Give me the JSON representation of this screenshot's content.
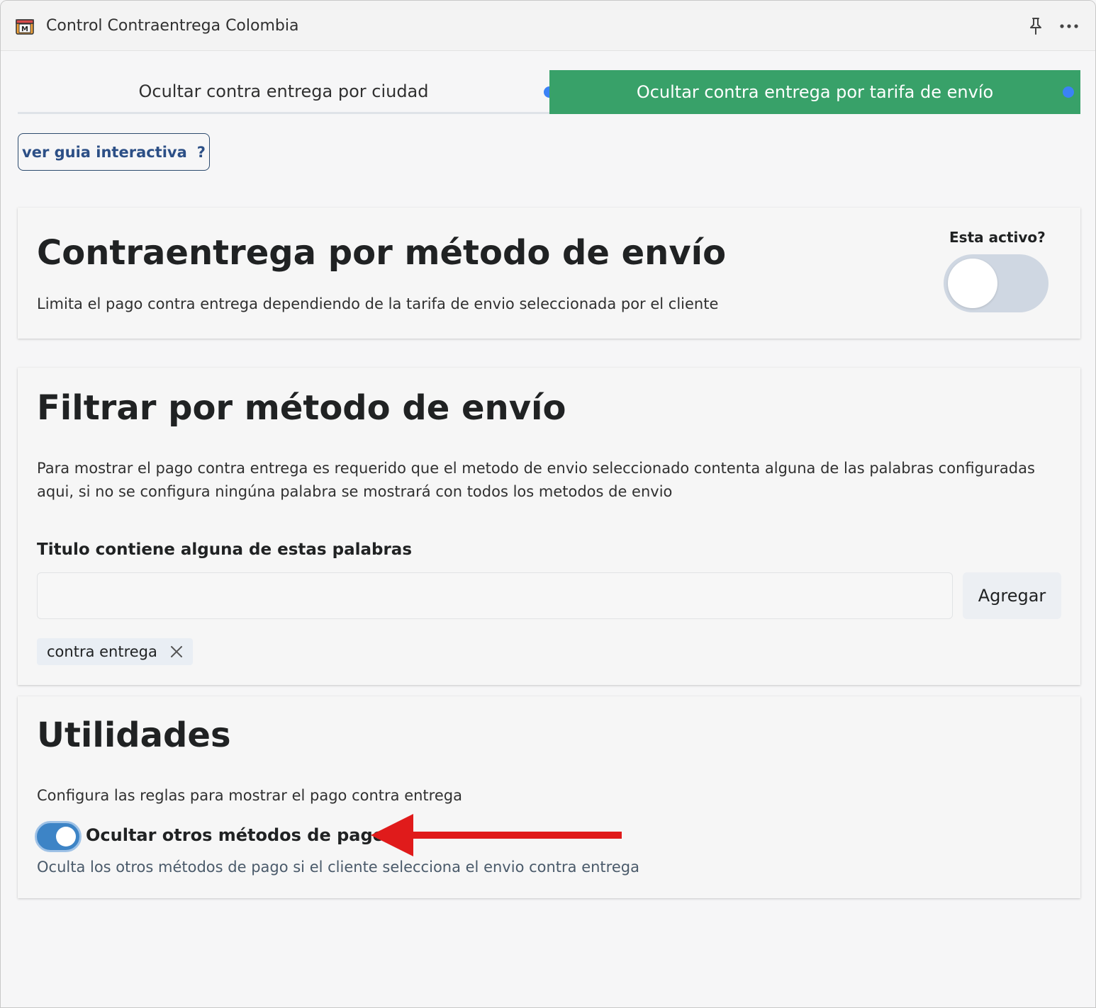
{
  "window": {
    "title": "Control Contraentrega Colombia",
    "logo_icon": "app-logo-icon",
    "pin_icon": "pin-icon",
    "more_icon": "more-options-icon"
  },
  "tabs": [
    {
      "label": "Ocultar contra entrega por ciudad",
      "selected": false
    },
    {
      "label": "Ocultar contra entrega por tarifa de envío",
      "selected": true
    }
  ],
  "colors": {
    "tab_active": "#38a169",
    "tab_dot": "#3b82f6",
    "toggle_on": "#3d84c6",
    "toggle_off": "#cfd7e2",
    "annotation_arrow": "#e01b1b"
  },
  "guide_button": {
    "label": "ver guia interactiva",
    "icon_text": "?"
  },
  "card_shipping_method": {
    "title": "Contraentrega por método de envío",
    "description": "Limita el pago contra entrega dependiendo de la tarifa de envio seleccionada por el cliente",
    "active_label": "Esta activo?",
    "active": false
  },
  "card_filter": {
    "title": "Filtrar por método de envío",
    "description": "Para mostrar el pago contra entrega es requerido que el metodo de envio seleccionado contenta alguna de las palabras configuradas aqui, si no se configura ningúna palabra se mostrará con todos los metodos de envio",
    "field_label": "Titulo contiene alguna de estas palabras",
    "input_value": "",
    "add_button_label": "Agregar",
    "tags": [
      "contra entrega"
    ]
  },
  "card_utilities": {
    "title": "Utilidades",
    "description": "Configura las reglas para mostrar el pago contra entrega",
    "toggle_label": "Ocultar otros métodos de pago",
    "toggle_on": true,
    "toggle_help": "Oculta los otros métodos de pago si el cliente selecciona el envio contra entrega"
  }
}
